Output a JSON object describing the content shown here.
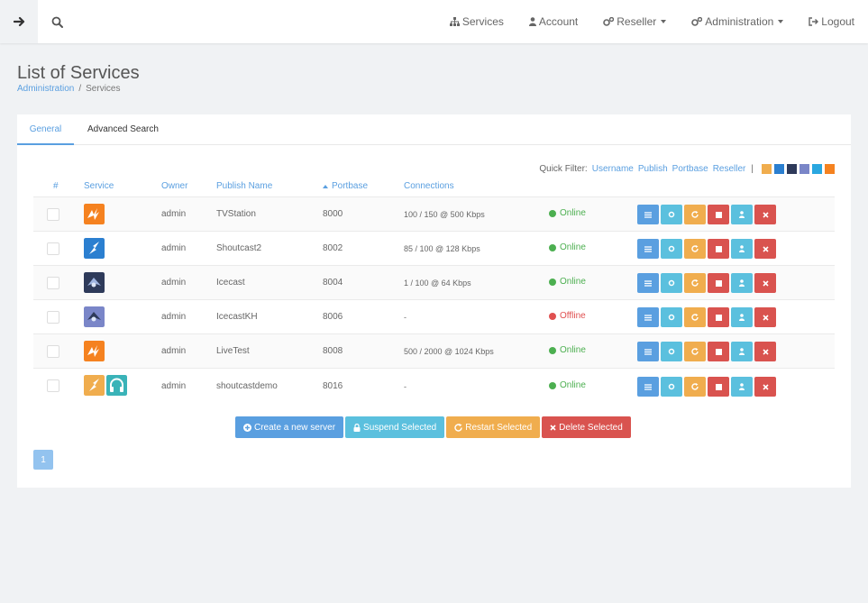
{
  "nav": {
    "services": "Services",
    "account": "Account",
    "reseller": "Reseller",
    "administration": "Administration",
    "logout": "Logout"
  },
  "page": {
    "title": "List of Services",
    "breadcrumb": [
      "Administration",
      "Services"
    ]
  },
  "tabs": [
    "General",
    "Advanced Search"
  ],
  "quick_filter": {
    "label": "Quick Filter:",
    "links": [
      "Username",
      "Publish",
      "Portbase",
      "Reseller"
    ],
    "separator": "|"
  },
  "table": {
    "headers": [
      "#",
      "Service",
      "Owner",
      "Publish Name",
      "Portbase",
      "Connections"
    ],
    "rows": [
      {
        "owner": "admin",
        "publish": "TVStation",
        "port": "8000",
        "conn": "100 / 150 @ 500 Kbps",
        "status": "Online"
      },
      {
        "owner": "admin",
        "publish": "Shoutcast2",
        "port": "8002",
        "conn": "85 / 100 @ 128 Kbps",
        "status": "Online"
      },
      {
        "owner": "admin",
        "publish": "Icecast",
        "port": "8004",
        "conn": "1 / 100 @ 64 Kbps",
        "status": "Online"
      },
      {
        "owner": "admin",
        "publish": "IcecastKH",
        "port": "8006",
        "conn": "-",
        "status": "Offline"
      },
      {
        "owner": "admin",
        "publish": "LiveTest",
        "port": "8008",
        "conn": "500 / 2000 @ 1024 Kbps",
        "status": "Online"
      },
      {
        "owner": "admin",
        "publish": "shoutcastdemo",
        "port": "8016",
        "conn": "-",
        "status": "Online"
      }
    ]
  },
  "buttons": {
    "create": "Create a new server",
    "suspend": "Suspend Selected",
    "restart": "Restart Selected",
    "delete": "Delete Selected"
  },
  "pagination": {
    "current": "1"
  },
  "colors": {
    "accent": "#5a9fe0",
    "online": "#4caf50",
    "offline": "#e05050",
    "cyan": "#5bc0de",
    "orange": "#f0ad4e",
    "red": "#d9534f"
  }
}
